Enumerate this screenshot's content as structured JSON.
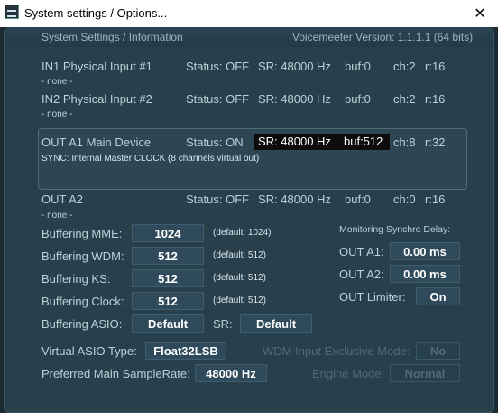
{
  "window": {
    "title": "System settings / Options...",
    "close_glyph": "✕"
  },
  "header": {
    "section_title": "System Settings / Information",
    "version": "Voicemeeter Version: 1.1.1.1 (64 bits)"
  },
  "devices": [
    {
      "name": "IN1 Physical Input #1",
      "status": "Status: OFF",
      "sr": "SR: 48000 Hz",
      "buf": "buf:0",
      "ch": "ch:2",
      "r": "r:16",
      "sub": "- none -"
    },
    {
      "name": "IN2 Physical Input #2",
      "status": "Status: OFF",
      "sr": "SR: 48000 Hz",
      "buf": "buf:0",
      "ch": "ch:2",
      "r": "r:16",
      "sub": "- none -"
    },
    {
      "name": "OUT A1 Main Device",
      "status": "Status: ON",
      "sr": "SR: 48000 Hz",
      "buf": "buf:512",
      "ch": "ch:8",
      "r": "r:32",
      "sub": "SYNC: Internal Master CLOCK (8 channels virtual out)"
    },
    {
      "name": "OUT A2",
      "status": "Status: OFF",
      "sr": "SR: 48000 Hz",
      "buf": "buf:0",
      "ch": "ch:0",
      "r": "r:16",
      "sub": "- none -"
    }
  ],
  "buffering": [
    {
      "label": "Buffering MME:",
      "value": "1024",
      "default": "(default: 1024)"
    },
    {
      "label": "Buffering WDM:",
      "value": "512",
      "default": "(default: 512)"
    },
    {
      "label": "Buffering KS:",
      "value": "512",
      "default": "(default: 512)"
    },
    {
      "label": "Buffering Clock:",
      "value": "512",
      "default": "(default: 512)"
    }
  ],
  "asio": {
    "label": "Buffering ASIO:",
    "value": "Default",
    "sr_label": "SR:",
    "sr_value": "Default"
  },
  "monitoring": {
    "title": "Monitoring Synchro Delay:",
    "out_a1_label": "OUT A1:",
    "out_a1_value": "0.00 ms",
    "out_a2_label": "OUT A2:",
    "out_a2_value": "0.00 ms",
    "limiter_label": "OUT Limiter:",
    "limiter_value": "On"
  },
  "virtual_asio": {
    "label": "Virtual ASIO Type:",
    "value": "Float32LSB"
  },
  "samplerate": {
    "label": "Preferred Main SampleRate:",
    "value": "48000 Hz"
  },
  "wdm_exclusive": {
    "label": "WDM Input Exclusive Mode:",
    "value": "No"
  },
  "engine": {
    "label": "Engine Mode:",
    "value": "Normal"
  }
}
